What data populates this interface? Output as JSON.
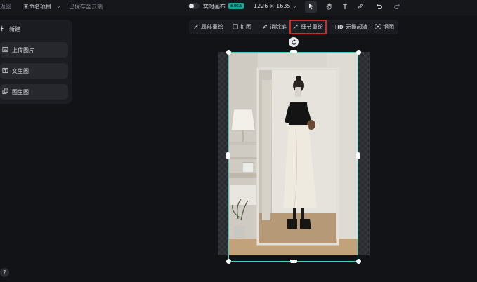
{
  "topbar": {
    "back_label": "返回",
    "project_name": "未命名项目",
    "saved_status": "已保存至云端",
    "realtime_label": "实时画布",
    "realtime_badge": "Beta",
    "canvas_size": "1226 × 1635",
    "icons": [
      "cursor-icon",
      "hand-icon",
      "text-icon",
      "pen-icon",
      "undo-icon",
      "redo-icon"
    ]
  },
  "left_panel": {
    "new_label": "新建",
    "items": [
      {
        "label": "上传图片",
        "icon": "image-upload-icon"
      },
      {
        "label": "文生图",
        "icon": "text-to-image-icon"
      },
      {
        "label": "图生图",
        "icon": "image-to-image-icon"
      }
    ]
  },
  "toolbar": {
    "tools": [
      {
        "label": "局部重绘",
        "icon": "brush-icon"
      },
      {
        "label": "扩图",
        "icon": "expand-icon"
      },
      {
        "label": "消除笔",
        "icon": "eraser-pen-icon"
      },
      {
        "label": "细节重绘",
        "icon": "detail-wand-icon",
        "selected": true
      },
      {
        "label": "无损超清",
        "icon": "hd-icon",
        "prefix": "HD"
      },
      {
        "label": "抠图",
        "icon": "cutout-icon"
      }
    ]
  },
  "help": {
    "glyph": "?"
  },
  "colors": {
    "background": "#121317",
    "panel": "#1b1c21",
    "selection": "#3ed1c4",
    "highlight": "#d82a24",
    "badge": "#1aa89b"
  }
}
